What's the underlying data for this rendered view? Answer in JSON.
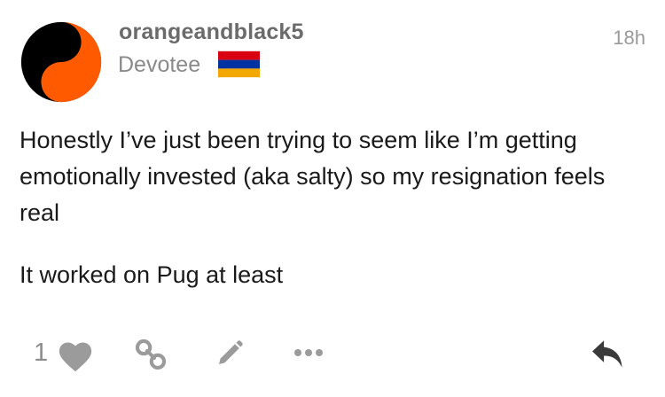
{
  "post": {
    "username": "orangeandblack5",
    "user_title": "Devotee",
    "timestamp": "18h",
    "paragraphs": [
      "Honestly I’ve just been trying to seem like I’m getting emotionally invested (aka salty) so my resignation feels real",
      "It worked on Pug at least"
    ],
    "like_count": "1"
  },
  "icons": {
    "avatar": "yin-yang-avatar",
    "flag": "armenia-flag",
    "like": "heart-icon",
    "share": "link-icon",
    "edit": "pencil-icon",
    "more": "ellipsis-icon",
    "reply": "reply-icon"
  },
  "colors": {
    "avatar_orange": "#ff5a00",
    "avatar_black": "#000000",
    "flag_red": "#d90012",
    "flag_blue": "#0033a0",
    "flag_orange": "#f2a800",
    "icon_gray": "#9b9b9b"
  }
}
